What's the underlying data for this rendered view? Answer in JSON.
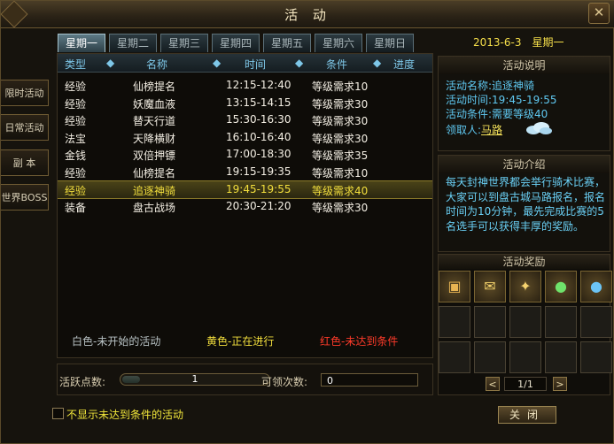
{
  "window": {
    "title": "活 动",
    "close_glyph": "✕"
  },
  "tabs": [
    "星期一",
    "星期二",
    "星期三",
    "星期四",
    "星期五",
    "星期六",
    "星期日"
  ],
  "active_tab": 0,
  "date": {
    "day": "2013-6-3",
    "weekday": "星期一"
  },
  "sidebar": [
    "限时活动",
    "日常活动",
    "副  本",
    "世界BOSS"
  ],
  "list": {
    "headers": {
      "type": "类型",
      "name": "名称",
      "time": "时间",
      "cond": "条件",
      "progress": "进度"
    },
    "rows": [
      {
        "type": "经验",
        "name": "仙榜提名",
        "time": "12:15-12:40",
        "cond": "等级需求10"
      },
      {
        "type": "经验",
        "name": "妖魔血液",
        "time": "13:15-14:15",
        "cond": "等级需求30"
      },
      {
        "type": "经验",
        "name": "替天行道",
        "time": "15:30-16:30",
        "cond": "等级需求30"
      },
      {
        "type": "法宝",
        "name": "天降横财",
        "time": "16:10-16:40",
        "cond": "等级需求30"
      },
      {
        "type": "金钱",
        "name": "双倍押镖",
        "time": "17:00-18:30",
        "cond": "等级需求35"
      },
      {
        "type": "经验",
        "name": "仙榜提名",
        "time": "19:15-19:35",
        "cond": "等级需求10"
      },
      {
        "type": "经验",
        "name": "追逐神骑",
        "time": "19:45-19:55",
        "cond": "等级需求40",
        "active": true
      },
      {
        "type": "装备",
        "name": "盘古战场",
        "time": "20:30-21:20",
        "cond": "等级需求30"
      }
    ]
  },
  "legend": {
    "white": "白色-未开始的活动",
    "yellow": "黄色-正在进行",
    "red": "红色-未达到条件"
  },
  "activity_points": {
    "label": "活跃点数:",
    "value": "1",
    "fill_fraction": 0.12
  },
  "claim_count": {
    "label": "可领次数:",
    "value": "0"
  },
  "hide_option": {
    "label": "不显示未达到条件的活动"
  },
  "info": {
    "header": "活动说明",
    "name_label": "活动名称:",
    "name": "追逐神骑",
    "time_label": "活动时间:",
    "time": "19:45-19:55",
    "cond_label": "活动条件:",
    "cond": "需要等级40",
    "leader_label": "领取人:",
    "leader": "马路"
  },
  "intro": {
    "header": "活动介绍",
    "text": "每天封神世界都会举行骑术比赛，大家可以到盘古城马路报名，报名时间为10分钟，最先完成比赛的5名选手可以获得丰厚的奖励。"
  },
  "rewards": {
    "header": "活动奖励",
    "page": "1/1",
    "prev": "<",
    "next": ">",
    "items": [
      "book-icon",
      "scroll-icon",
      "title-icon",
      "green-gourd-icon",
      "blue-gourd-icon"
    ]
  },
  "close_button": "关闭",
  "colors": {
    "accent_yellow": "#f3df3d",
    "info_blue": "#5fc8f1",
    "legend_red": "#ff3b2a"
  }
}
